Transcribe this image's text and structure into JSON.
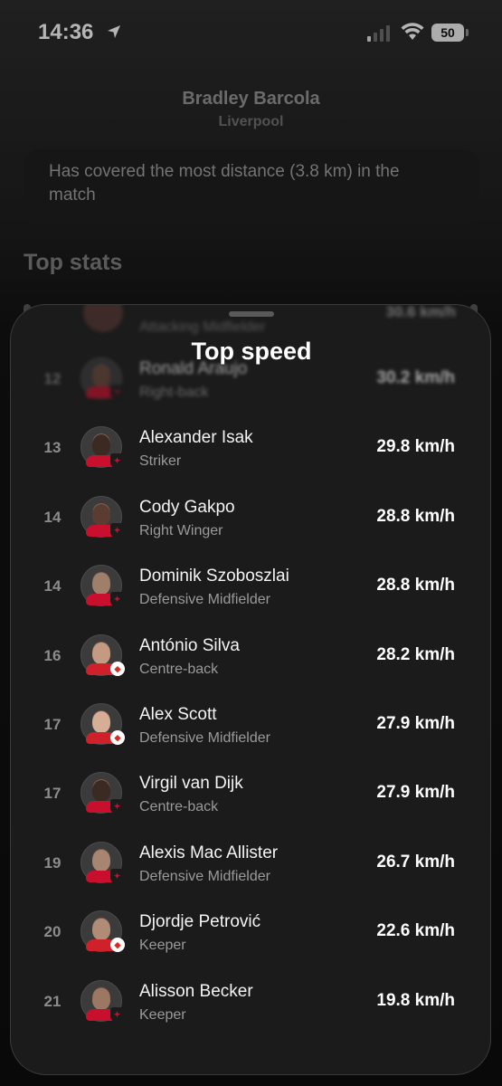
{
  "status_bar": {
    "time": "14:36",
    "battery": "50",
    "icons": [
      "location-arrow-icon",
      "signal-icon",
      "wifi-icon",
      "battery-icon"
    ]
  },
  "background": {
    "player_name": "Bradley Barcola",
    "team": "Liverpool",
    "fact": "Has covered the most distance (3.8 km) in the match",
    "section_title": "Top stats"
  },
  "sheet": {
    "title": "Top speed",
    "ghost_row": {
      "position": "Attacking Midfielder",
      "value": "30.6 km/h"
    },
    "rows": [
      {
        "rank": "12",
        "name": "Ronald Araujo",
        "position": "Right-back",
        "value": "30.2 km/h",
        "club": "lfc"
      },
      {
        "rank": "13",
        "name": "Alexander Isak",
        "position": "Striker",
        "value": "29.8 km/h",
        "club": "lfc"
      },
      {
        "rank": "14",
        "name": "Cody Gakpo",
        "position": "Right Winger",
        "value": "28.8 km/h",
        "club": "lfc"
      },
      {
        "rank": "14",
        "name": "Dominik Szoboszlai",
        "position": "Defensive Midfielder",
        "value": "28.8 km/h",
        "club": "lfc"
      },
      {
        "rank": "16",
        "name": "António Silva",
        "position": "Centre-back",
        "value": "28.2 km/h",
        "club": "afcb"
      },
      {
        "rank": "17",
        "name": "Alex Scott",
        "position": "Defensive Midfielder",
        "value": "27.9 km/h",
        "club": "afcb"
      },
      {
        "rank": "17",
        "name": "Virgil van Dijk",
        "position": "Centre-back",
        "value": "27.9 km/h",
        "club": "lfc"
      },
      {
        "rank": "19",
        "name": "Alexis Mac Allister",
        "position": "Defensive Midfielder",
        "value": "26.7 km/h",
        "club": "lfc"
      },
      {
        "rank": "20",
        "name": "Djordje Petrović",
        "position": "Keeper",
        "value": "22.6 km/h",
        "club": "afcb"
      },
      {
        "rank": "21",
        "name": "Alisson Becker",
        "position": "Keeper",
        "value": "19.8 km/h",
        "club": "lfc"
      }
    ]
  },
  "colors": {
    "sheet_bg": "#1b1b1b",
    "liverpool_red": "#c8102e",
    "bournemouth_red": "#da291c"
  }
}
